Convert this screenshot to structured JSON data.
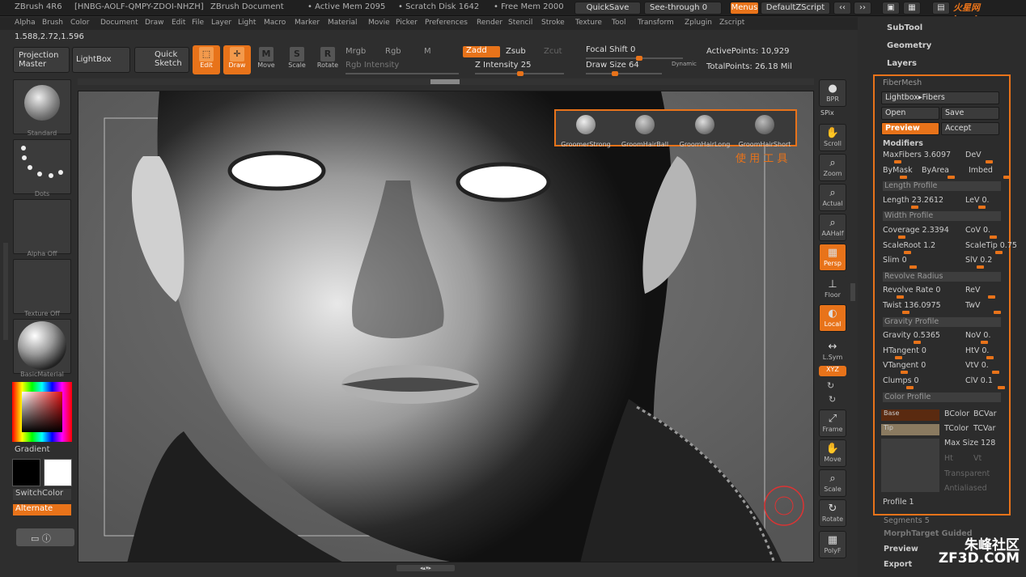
{
  "titlebar": {
    "app": "ZBrush 4R6",
    "serial": "[HNBG-AOLF-QMPY-ZDOI-NHZH]",
    "doc": "ZBrush Document",
    "active_mem": "• Active Mem 2095",
    "scratch": "• Scratch Disk 1642",
    "free_mem": "• Free Mem 2000",
    "quicksave": "QuickSave",
    "seethrough": "See-through   0",
    "menus": "Menus",
    "script": "DefaultZScript"
  },
  "menubar": [
    "Alpha",
    "Brush",
    "Color",
    "Document",
    "Draw",
    "Edit",
    "File",
    "Layer",
    "Light",
    "Macro",
    "Marker",
    "Material",
    "Movie",
    "Picker",
    "Preferences",
    "Render",
    "Stencil",
    "Stroke",
    "Texture",
    "Tool",
    "Transform",
    "Zplugin",
    "Zscript"
  ],
  "coords": "1.588,2.72,1.596",
  "shelf": {
    "projection_master": "Projection Master",
    "lightbox": "LightBox",
    "quick_sketch": "Quick Sketch",
    "edit": "Edit",
    "draw": "Draw",
    "move": "Move",
    "scale": "Scale",
    "rotate": "Rotate",
    "mrgb": "Mrgb",
    "rgb": "Rgb",
    "m": "M",
    "rgb_intensity": "Rgb Intensity",
    "zadd": "Zadd",
    "zsub": "Zsub",
    "zcut": "Zcut",
    "z_intensity": "Z Intensity 25",
    "focal_shift": "Focal Shift 0",
    "draw_size": "Draw Size 64",
    "dynamic": "Dynamic",
    "active_points": "ActivePoints: 10,929",
    "total_points": "TotalPoints: 26.18 Mil"
  },
  "left": {
    "standard": "Standard",
    "dots": "Dots",
    "alpha": "Alpha Off",
    "texture": "Texture Off",
    "material": "BasicMaterial",
    "gradient": "Gradient",
    "switch": "SwitchColor",
    "alternate": "Alternate"
  },
  "brushes": [
    {
      "label": "GroomerStrong"
    },
    {
      "label": "GroomHairBall"
    },
    {
      "label": "GroomHairLong"
    },
    {
      "label": "GroomHairShort"
    }
  ],
  "annotation": "使 用 工 具",
  "right_tools": [
    "BPR",
    "SPix",
    "Scroll",
    "Zoom",
    "Actual",
    "AAHalf",
    "Persp",
    "Floor",
    "Local",
    "L.Sym",
    "XYZ",
    "Frame",
    "Move",
    "Scale",
    "Rotate",
    "PolyF"
  ],
  "panel": {
    "subtool": "SubTool",
    "geometry": "Geometry",
    "layers": "Layers",
    "fibermesh": "FiberMesh",
    "lightbox_fibers": "Lightbox▸Fibers",
    "open": "Open",
    "save": "Save",
    "preview": "Preview",
    "accept": "Accept",
    "modifiers": "Modifiers",
    "rows": [
      [
        "MaxFibers 3.6097",
        "DeV"
      ],
      [
        "ByMask",
        "ByArea",
        "Imbed"
      ],
      [
        "Length Profile"
      ],
      [
        "Length 23.2612",
        "LeV 0."
      ],
      [
        "Width Profile"
      ],
      [
        "Coverage 2.3394",
        "CoV 0."
      ],
      [
        "ScaleRoot 1.2",
        "ScaleTip 0.75"
      ],
      [
        "Slim 0",
        "SlV 0.2"
      ],
      [
        "Revolve Radius"
      ],
      [
        "Revolve Rate 0",
        "ReV"
      ],
      [
        "Twist 136.0975",
        "TwV"
      ],
      [
        "Gravity Profile"
      ],
      [
        "Gravity 0.5365",
        "NoV 0."
      ],
      [
        "HTangent 0",
        "HtV 0."
      ],
      [
        "VTangent 0",
        "VtV 0."
      ],
      [
        "Clumps 0",
        "ClV 0.1"
      ],
      [
        "Color Profile"
      ]
    ],
    "base": "Base",
    "tip": "Tip",
    "bcolor": "BColor",
    "bcvar": "BCVar",
    "tcolor": "TColor",
    "tcvar": "TCVar",
    "maxsize": "Max Size 128",
    "ht": "Ht",
    "vt": "Vt",
    "transparent": "Transparent",
    "antialiased": "Antialiased",
    "profile1": "Profile 1",
    "segments": "Segments 5",
    "morph": "MorphTarget Guided",
    "preview2": "Preview",
    "export": "Export"
  },
  "watermark_top": "火星网 hxsd.com",
  "watermark_bottom": "朱峰社区 ZF3D.COM"
}
